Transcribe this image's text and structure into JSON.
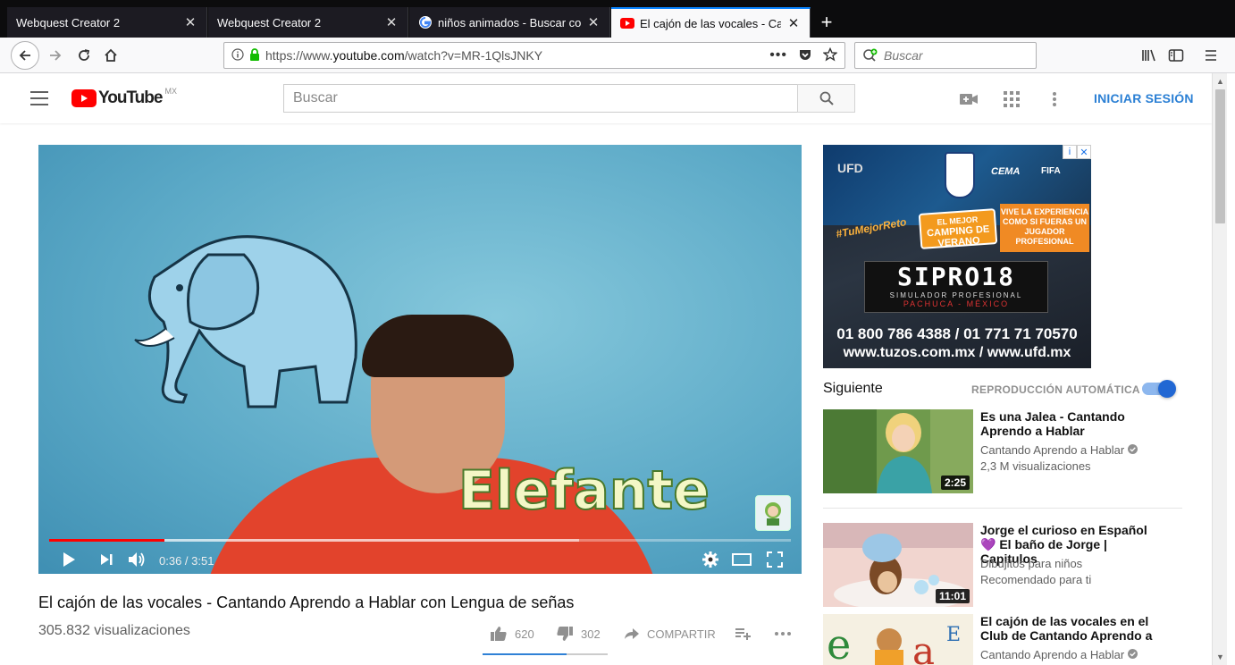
{
  "browser": {
    "tabs": [
      {
        "title": "Webquest Creator 2",
        "active": false
      },
      {
        "title": "Webquest Creator 2",
        "active": false
      },
      {
        "title": "niños animados - Buscar con G",
        "active": false
      },
      {
        "title": "El cajón de las vocales - Cantan",
        "active": true
      }
    ],
    "url_prefix": "https://www.",
    "url_host": "youtube.com",
    "url_path": "/watch?v=MR-1QlsJNKY",
    "search_placeholder": "Buscar"
  },
  "youtube": {
    "logo_text": "YouTube",
    "region": "MX",
    "search_placeholder": "Buscar",
    "signin_label": "INICIAR SESIÓN"
  },
  "video": {
    "caption_word": "Elefante",
    "time": "0:36 / 3:51",
    "progress_fraction": 0.156,
    "buffer_fraction": 0.715,
    "title": "El cajón de las vocales - Cantando Aprendo a Hablar con Lengua de señas",
    "views": "305.832 visualizaciones",
    "likes": "620",
    "dislikes": "302",
    "share_label": "COMPARTIR"
  },
  "ad": {
    "brand_left": "UFD",
    "campaign": "EL MEJOR CAMPING DE VERANO DE AMÉRICA",
    "campaign_top": "EL MEJOR",
    "campaign_main": "CAMPING DE VERANO",
    "tagline": "VIVE LA EXPERIENCIA COMO SI FUERAS UN JUGADOR PROFESIONAL",
    "hashtag": "#TuMejorReto",
    "product": "SIPRO18",
    "product_sub": "SIMULADOR PROFESIONAL",
    "location": "PACHUCA - MÉXICO",
    "phones": "01 800 786 4388 / 01 771 71 70570",
    "sites": "www.tuzos.com.mx / www.ufd.mx",
    "cema": "CEMA",
    "fifa": "FIFA"
  },
  "upnext": {
    "label": "Siguiente",
    "autoplay_label": "REPRODUCCIÓN AUTOMÁTICA",
    "autoplay_on": true,
    "items": [
      {
        "title": "Es una Jalea - Cantando Aprendo a Hablar",
        "channel": "Cantando Aprendo a Hablar",
        "verified": true,
        "meta": "2,3 M visualizaciones",
        "duration": "2:25"
      },
      {
        "title": "Jorge el curioso en Español 💜 El baño de Jorge | Capitulos",
        "channel": "Dibujitos para niños",
        "verified": false,
        "meta": "Recomendado para ti",
        "duration": "11:01"
      },
      {
        "title": "El cajón de las vocales en el Club de Cantando Aprendo a",
        "channel": "Cantando Aprendo a Hablar",
        "verified": true,
        "meta": "",
        "duration": ""
      }
    ]
  },
  "colors": {
    "youtube_red": "#ff0000",
    "accent_blue": "#2167d3",
    "firefox_blue": "#0a84ff"
  }
}
